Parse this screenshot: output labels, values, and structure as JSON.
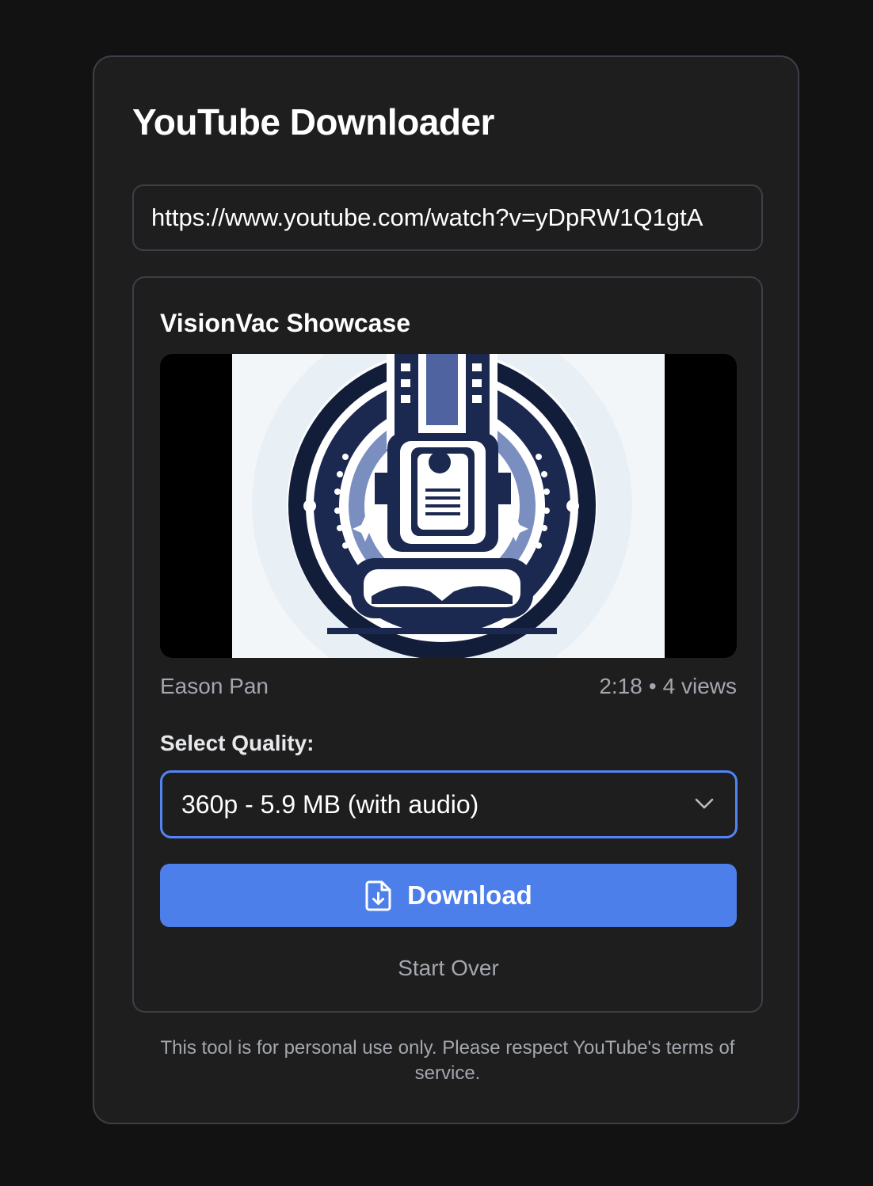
{
  "app": {
    "title": "YouTube Downloader"
  },
  "url_input": {
    "value": "https://www.youtube.com/watch?v=yDpRW1Q1gtA"
  },
  "video": {
    "title": "VisionVac Showcase",
    "channel": "Eason Pan",
    "duration": "2:18",
    "separator": "•",
    "views": "4 views",
    "thumbnail_icon": "vacuum-robot-logo"
  },
  "quality": {
    "label": "Select Quality:",
    "selected": "360p - 5.9 MB (with audio)"
  },
  "actions": {
    "download_label": "Download",
    "start_over_label": "Start Over"
  },
  "footer": {
    "disclaimer": "This tool is for personal use only. Please respect YouTube's terms of service."
  },
  "colors": {
    "page_background": "#121213",
    "card_background": "#1e1e1f",
    "border": "#3b3f47",
    "accent": "#4d7feb",
    "muted_text": "#a4a7ae"
  }
}
